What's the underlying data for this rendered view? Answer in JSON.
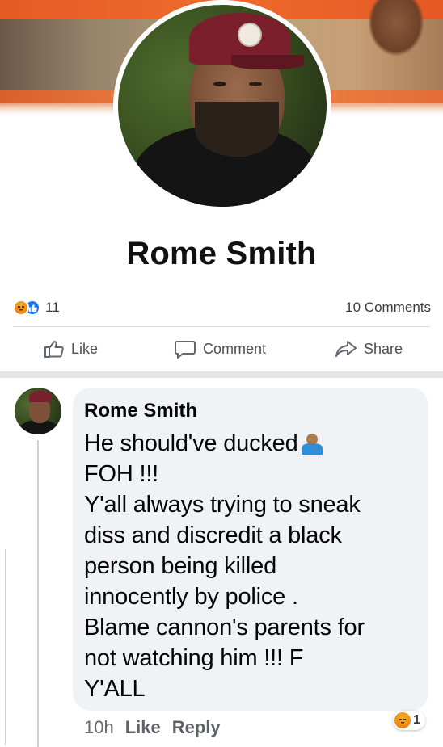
{
  "profile": {
    "name": "Rome Smith"
  },
  "post": {
    "reaction_count": "11",
    "comments_count": "10 Comments",
    "actions": {
      "like": "Like",
      "comment": "Comment",
      "share": "Share"
    }
  },
  "comment": {
    "author": "Rome Smith",
    "lines": [
      "He should've ducked",
      "FOH !!!",
      "Y'all always trying to sneak",
      "diss and discredit a black",
      "person being killed",
      "innocently by police .",
      "Blame cannon's parents for",
      "not watching him !!! F",
      "Y'ALL"
    ],
    "time": "10h",
    "like_label": "Like",
    "reply_label": "Reply",
    "reaction_count": "1"
  },
  "icons": {
    "reaction_angry": "angry-face-icon",
    "reaction_like": "thumbs-up-icon",
    "shrug_emoji": "person-shrugging-emoji"
  },
  "colors": {
    "facebook_blue": "#1877f2",
    "angry_orange": "#e9710f",
    "bubble_bg": "#f0f2f5"
  }
}
